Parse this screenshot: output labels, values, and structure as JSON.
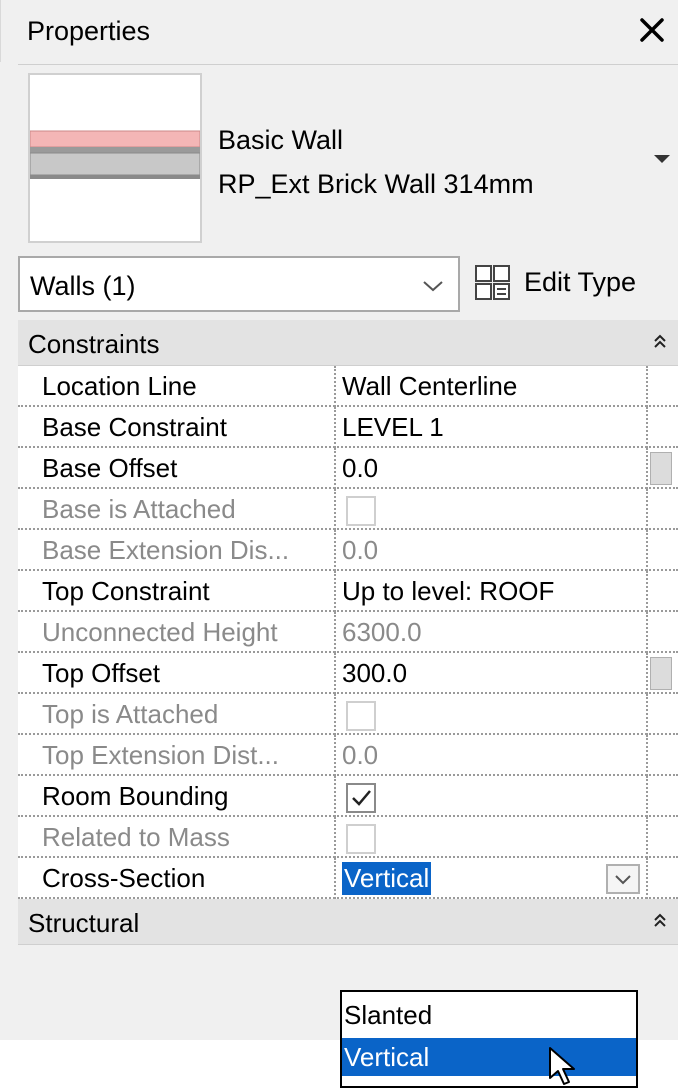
{
  "header": {
    "title": "Properties"
  },
  "type_selector": {
    "family": "Basic Wall",
    "type_name": "RP_Ext Brick Wall 314mm"
  },
  "filter": {
    "label": "Walls (1)",
    "edit_type_label": "Edit Type"
  },
  "groups": [
    {
      "label": "Constraints",
      "rows": [
        {
          "name": "Location Line",
          "value": "Wall Centerline"
        },
        {
          "name": "Base Constraint",
          "value": "LEVEL 1"
        },
        {
          "name": "Base Offset",
          "value": "0.0"
        },
        {
          "name": "Base is Attached",
          "value": "",
          "checked": false
        },
        {
          "name": "Base Extension Dis...",
          "value": "0.0"
        },
        {
          "name": "Top Constraint",
          "value": "Up to level: ROOF"
        },
        {
          "name": "Unconnected Height",
          "value": "6300.0"
        },
        {
          "name": "Top Offset",
          "value": "300.0"
        },
        {
          "name": "Top is Attached",
          "value": "",
          "checked": false
        },
        {
          "name": "Top Extension Dist...",
          "value": "0.0"
        },
        {
          "name": "Room Bounding",
          "value": "",
          "checked": true
        },
        {
          "name": "Related to Mass",
          "value": "",
          "checked": false
        },
        {
          "name": "Cross-Section",
          "value": "Vertical"
        }
      ]
    },
    {
      "label": "Structural"
    }
  ],
  "cross_section_dropdown": {
    "options": [
      "Slanted",
      "Vertical"
    ],
    "selected": "Vertical"
  },
  "colors": {
    "selection": "#0a64c8",
    "panel_bg": "#f0f0f0",
    "group_bg": "#e3e3e3"
  }
}
